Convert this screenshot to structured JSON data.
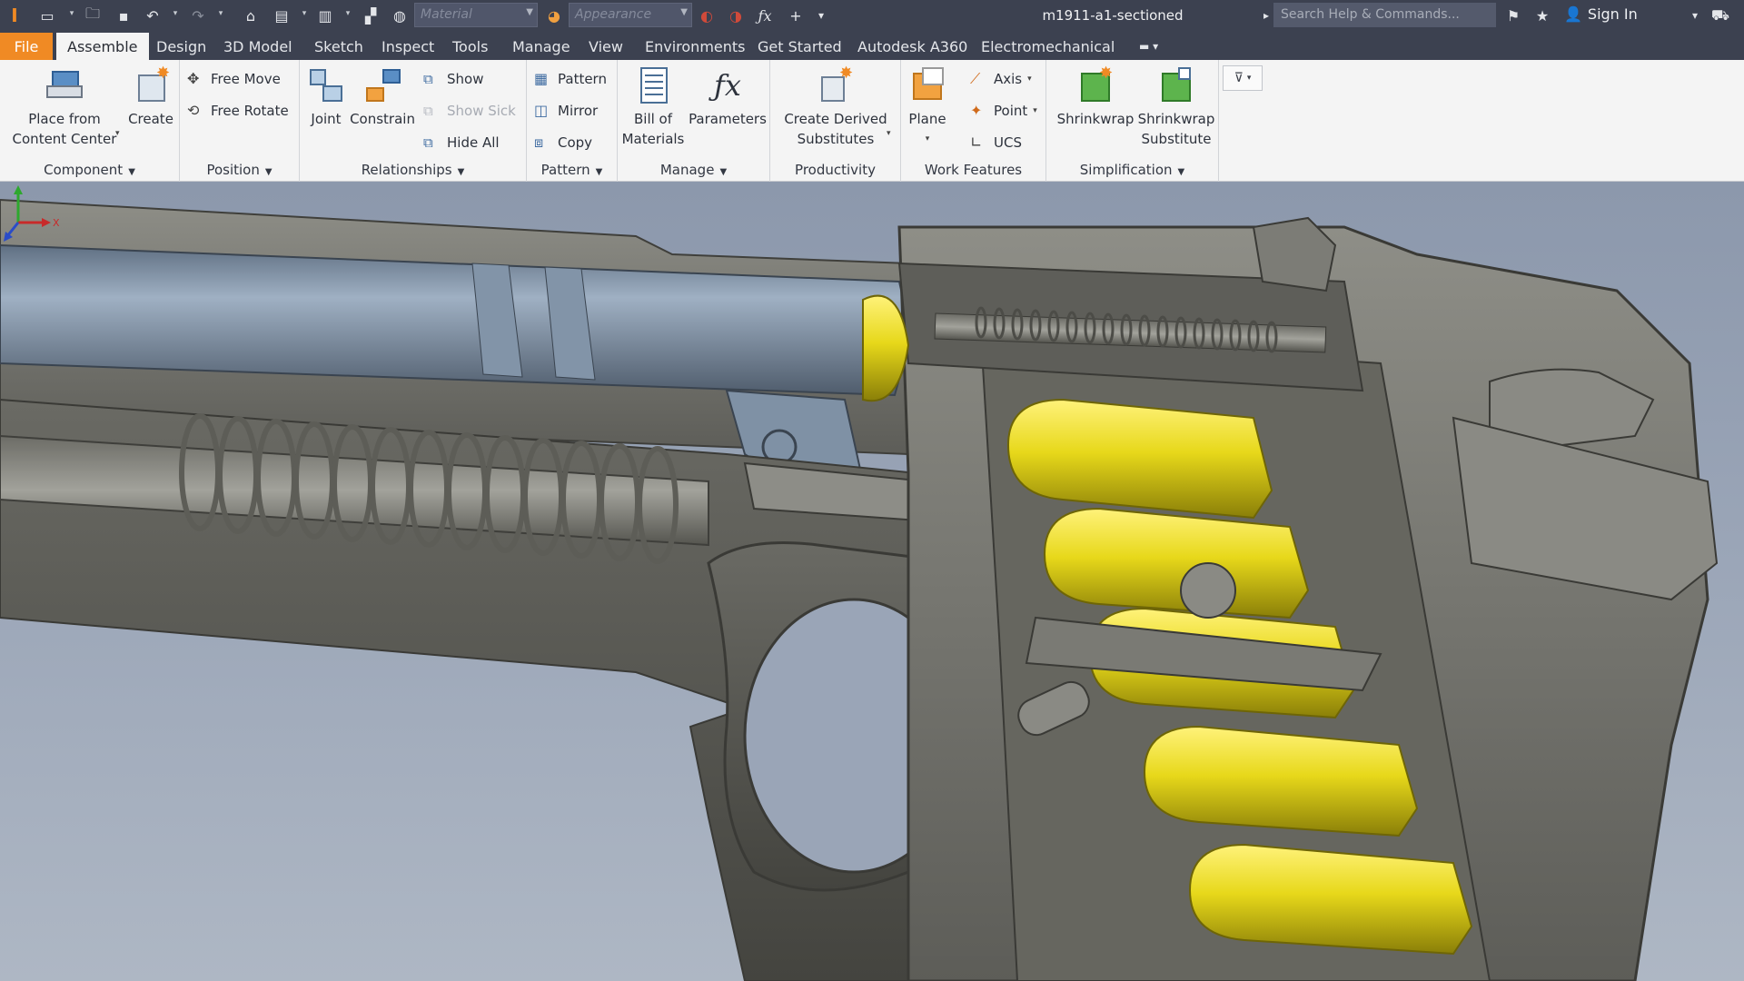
{
  "titlebar": {
    "material_placeholder": "Material",
    "appearance_placeholder": "Appearance",
    "document_title": "m1911-a1-sectioned",
    "search_placeholder": "Search Help & Commands...",
    "sign_in": "Sign In"
  },
  "tabs": [
    {
      "label": "File"
    },
    {
      "label": "Assemble",
      "active": true
    },
    {
      "label": "Design"
    },
    {
      "label": "3D Model"
    },
    {
      "label": "Sketch"
    },
    {
      "label": "Inspect"
    },
    {
      "label": "Tools"
    },
    {
      "label": "Manage"
    },
    {
      "label": "View"
    },
    {
      "label": "Environments"
    },
    {
      "label": "Get Started"
    },
    {
      "label": "Autodesk A360"
    },
    {
      "label": "Electromechanical"
    }
  ],
  "ribbon": {
    "component": {
      "title": "Component",
      "place_line1": "Place from",
      "place_line2": "Content Center",
      "create": "Create"
    },
    "position": {
      "title": "Position",
      "free_move": "Free Move",
      "free_rotate": "Free Rotate"
    },
    "relationships": {
      "title": "Relationships",
      "joint": "Joint",
      "constrain": "Constrain",
      "show": "Show",
      "show_sick": "Show Sick",
      "hide_all": "Hide All"
    },
    "pattern": {
      "title": "Pattern",
      "pattern": "Pattern",
      "mirror": "Mirror",
      "copy": "Copy"
    },
    "manage": {
      "title": "Manage",
      "bom_line1": "Bill of",
      "bom_line2": "Materials",
      "parameters": "Parameters"
    },
    "productivity": {
      "title": "Productivity",
      "derived_line1": "Create Derived",
      "derived_line2": "Substitutes"
    },
    "work_features": {
      "title": "Work Features",
      "plane": "Plane",
      "axis": "Axis",
      "point": "Point",
      "ucs": "UCS"
    },
    "simplification": {
      "title": "Simplification",
      "shrinkwrap": "Shrinkwrap",
      "shrinkwrap_sub_line1": "Shrinkwrap",
      "shrinkwrap_sub_line2": "Substitute"
    }
  },
  "viewport": {
    "triad_x": "X"
  },
  "colors": {
    "accent": "#f08a24",
    "titlebar": "#3c4150",
    "ribbon": "#f4f4f4",
    "metal": "#7a7a74",
    "barrel": "#7e8fa3",
    "cartridge": "#e2d61a"
  }
}
